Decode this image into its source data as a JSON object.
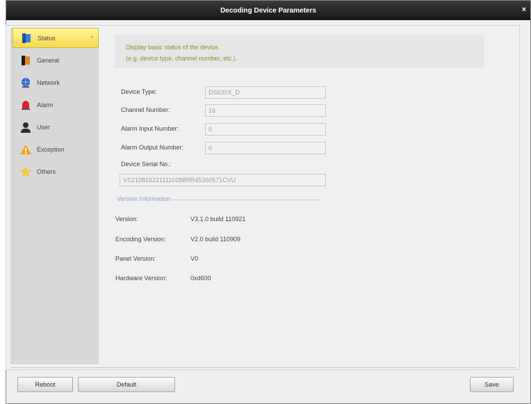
{
  "window": {
    "title": "Decoding Device Parameters",
    "close_glyph": "×"
  },
  "sidebar": {
    "items": [
      {
        "label": "Status",
        "icon": "status-book-icon",
        "active": true
      },
      {
        "label": "General",
        "icon": "general-book-icon"
      },
      {
        "label": "Network",
        "icon": "network-globe-icon"
      },
      {
        "label": "Alarm",
        "icon": "alarm-siren-icon"
      },
      {
        "label": "User",
        "icon": "user-icon"
      },
      {
        "label": "Exception",
        "icon": "warning-icon"
      },
      {
        "label": "Others",
        "icon": "star-icon"
      }
    ]
  },
  "info": {
    "line1": "Display basic status of the device.",
    "line2": "(e.g. device type, channel number, etc.)."
  },
  "device": {
    "type_label": "Device Type:",
    "type_value": "DS630X_D",
    "channel_label": "Channel Number:",
    "channel_value": "16",
    "alarm_in_label": "Alarm Input Number:",
    "alarm_in_value": "0",
    "alarm_out_label": "Alarm Output Number:",
    "alarm_out_value": "0",
    "serial_label": "Device Serial No.:",
    "serial_value": "VS2108162211110288RR45360571CVU"
  },
  "version_info": {
    "section_title": "Version Information",
    "version_label": "Version:",
    "version_value": "V3.1.0 build 110921",
    "encoding_label": "Encoding Version:",
    "encoding_value": "V2.0 build 110909",
    "panel_label": "Panel Version:",
    "panel_value": "V0",
    "hardware_label": "Hardware Version:",
    "hardware_value": "0xd600"
  },
  "buttons": {
    "reboot": "Reboot",
    "default": "Default",
    "save": "Save"
  },
  "colors": {
    "titlebar": "#1e1e1e",
    "active_item": "#f7d94b",
    "info_text": "#7a9a2a",
    "section_title": "#8aa4c8"
  }
}
